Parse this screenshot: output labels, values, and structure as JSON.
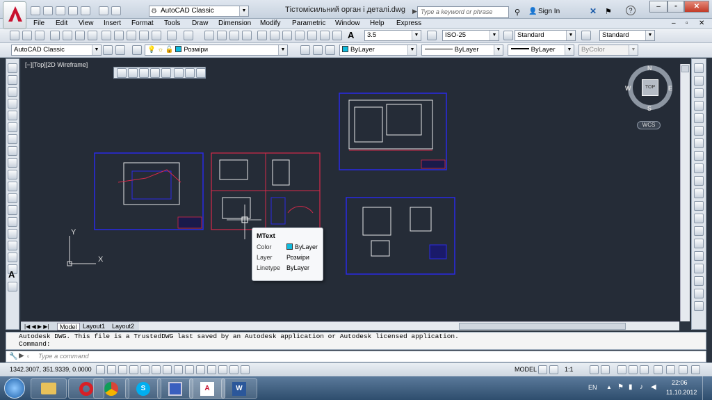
{
  "window": {
    "workspace": "AutoCAD Classic",
    "doc_title": "Тістомісильний орган і деталі.dwg",
    "search_placeholder": "Type a keyword or phrase",
    "sign_in": "Sign In"
  },
  "menus": [
    "File",
    "Edit",
    "View",
    "Insert",
    "Format",
    "Tools",
    "Draw",
    "Dimension",
    "Modify",
    "Parametric",
    "Window",
    "Help",
    "Express"
  ],
  "styles": {
    "text_height": "3.5",
    "dim_style": "ISO-25",
    "table_style": "Standard",
    "multileader_style": "Standard"
  },
  "layers": {
    "workspace": "AutoCAD Classic",
    "current_layer": "Розміри",
    "color": "ByLayer",
    "linetype": "ByLayer",
    "lineweight": "ByLayer",
    "plot_style": "ByColor"
  },
  "viewport": {
    "label": "[−][Top][2D Wireframe]",
    "cube_face": "TOP",
    "north": "N",
    "south": "S",
    "east": "E",
    "west": "W",
    "wcs": "WCS",
    "ucs_x": "X",
    "ucs_y": "Y"
  },
  "tooltip": {
    "title": "MText",
    "rows": [
      {
        "k": "Color",
        "v": "ByLayer"
      },
      {
        "k": "Layer",
        "v": "Розміри"
      },
      {
        "k": "Linetype",
        "v": "ByLayer"
      }
    ]
  },
  "tabs": [
    "Model",
    "Layout1",
    "Layout2"
  ],
  "command": {
    "history": "Autodesk DWG.  This file is a TrustedDWG last saved by an Autodesk application or Autodesk licensed application.",
    "prompt": "Command:",
    "input_placeholder": "Type a command"
  },
  "status": {
    "coords": "1342.3007, 351.9339, 0.0000",
    "model": "MODEL",
    "scale": "1:1"
  },
  "taskbar": {
    "lang": "EN",
    "time": "22:06",
    "date": "11.10.2012"
  },
  "colors": {
    "canvas": "#252c37",
    "sheet_blue": "#2a2ae6",
    "sheet_red": "#d62a4a"
  }
}
